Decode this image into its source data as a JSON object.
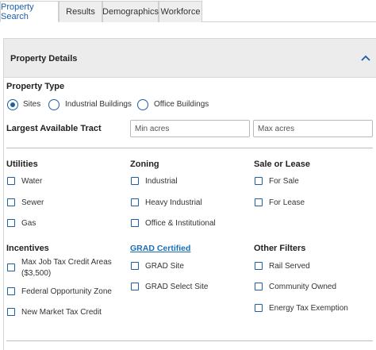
{
  "tabs": [
    {
      "label": "Property Search",
      "active": true
    },
    {
      "label": "Results",
      "active": false
    },
    {
      "label": "Demographics",
      "active": false
    },
    {
      "label": "Workforce",
      "active": false
    }
  ],
  "panel": {
    "title": "Property Details"
  },
  "property_type": {
    "heading": "Property Type",
    "options": [
      {
        "label": "Sites",
        "checked": true
      },
      {
        "label": "Industrial Buildings",
        "checked": false
      },
      {
        "label": "Office Buildings",
        "checked": false
      }
    ]
  },
  "tract": {
    "label": "Largest Available Tract",
    "min_placeholder": "Min acres",
    "max_placeholder": "Max acres"
  },
  "utilities": {
    "heading": "Utilities",
    "items": [
      "Water",
      "Sewer",
      "Gas"
    ]
  },
  "zoning": {
    "heading": "Zoning",
    "items": [
      "Industrial",
      "Heavy Industrial",
      "Office & Institutional"
    ]
  },
  "sale_lease": {
    "heading": "Sale or Lease",
    "items": [
      "For Sale",
      "For Lease"
    ]
  },
  "incentives": {
    "heading": "Incentives",
    "items": [
      "Max Job Tax Credit Areas",
      "($3,500)",
      "Federal Opportunity Zone",
      "New Market Tax Credit"
    ]
  },
  "grad": {
    "heading": "GRAD Certified",
    "items": [
      "GRAD Site",
      "GRAD Select Site"
    ]
  },
  "other_filters": {
    "heading": "Other Filters",
    "items": [
      "Rail Served",
      "Community Owned",
      "Energy Tax Exemption"
    ]
  },
  "colors": {
    "accent": "#1b5fa7",
    "link": "#1b6fb8",
    "header_bg": "#ececec"
  }
}
